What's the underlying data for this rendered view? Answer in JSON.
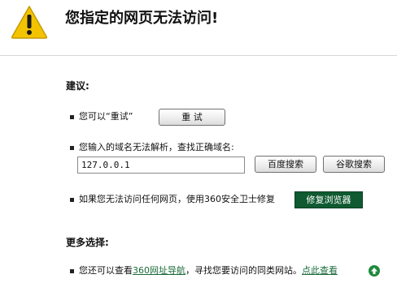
{
  "header": {
    "title": "您指定的网页无法访问!",
    "icon": "warning-icon",
    "accent_yellow": "#f4c300"
  },
  "suggestions": {
    "heading": "建议:",
    "retry": {
      "text": "您可以“重试”",
      "button_label": "重 试"
    },
    "domain": {
      "text": "您输入的域名无法解析，查找正确域名:",
      "input_value": "127.0.0.1",
      "baidu_button": "百度搜索",
      "google_button": "谷歌搜索"
    },
    "repair": {
      "text": "如果您无法访问任何网页，使用360安全卫士修复",
      "button_label": "修复浏览器",
      "button_color": "#0f5a31"
    }
  },
  "more": {
    "heading": "更多选择:",
    "line_prefix": "您还可以查看",
    "nav_link": "360网址导航",
    "line_middle": "，寻找您要访问的同类网站。",
    "view_link": "点此查看",
    "link_color": "#1a6b3a"
  }
}
